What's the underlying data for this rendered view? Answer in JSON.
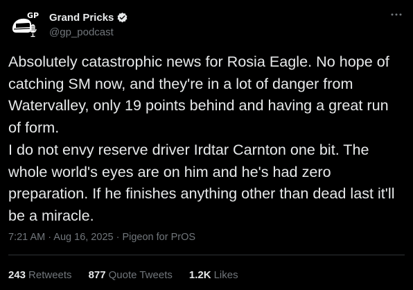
{
  "author": {
    "display_name": "Grand Pricks",
    "handle": "@gp_podcast",
    "avatar_text": "GP",
    "verified_icon": "verified-badge-icon",
    "more_icon": "more-options-icon"
  },
  "tweet": {
    "text": "Absolutely catastrophic news for Rosia Eagle. No hope of catching SM now, and they're in a lot of danger from Watervalley, only 19 points behind and having a great run of form.\nI do not envy reserve driver Irdtar Carnton one bit. The whole world's eyes are on him and he's had zero preparation. If he finishes anything other than dead last it'll be a miracle.",
    "time": "7:21 AM",
    "date": "Aug 16, 2025",
    "source": "Pigeon for PrOS"
  },
  "stats": {
    "retweets_count": "243",
    "retweets_label": "Retweets",
    "quotes_count": "877",
    "quotes_label": "Quote Tweets",
    "likes_count": "1.2K",
    "likes_label": "Likes"
  },
  "colors": {
    "background": "#000000",
    "text": "#e7e9ea",
    "muted": "#71767b",
    "divider": "#2f3336"
  }
}
